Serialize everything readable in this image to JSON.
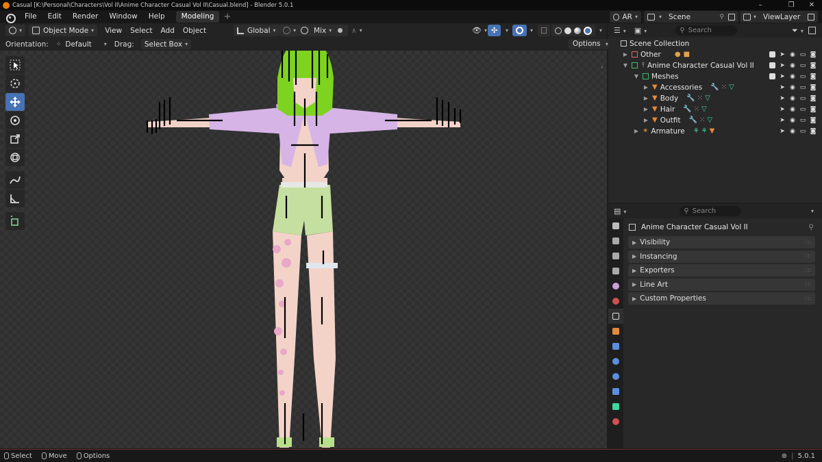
{
  "window": {
    "title": "Casual [K:\\Personal\\Characters\\Vol II\\Anime Character Casual Vol II\\Casual.blend] - Blender 5.0.1",
    "minimize": "–",
    "maximize": "❐",
    "close": "✕"
  },
  "menubar": {
    "items": [
      "File",
      "Edit",
      "Render",
      "Window",
      "Help"
    ],
    "workspace_tab": "Modeling",
    "add_tab": "+",
    "engine": "AR",
    "scene": "Scene",
    "view_layer": "ViewLayer"
  },
  "viewport_header": {
    "mode": "Object Mode",
    "menus": [
      "View",
      "Select",
      "Add",
      "Object"
    ],
    "transform_orientation": "Global",
    "snap_mode": "Mix"
  },
  "viewport_subheader": {
    "orientation_label": "Orientation:",
    "orientation_value": "Default",
    "drag_label": "Drag:",
    "drag_value": "Select Box",
    "options": "Options"
  },
  "tools": [
    "select-box",
    "cursor",
    "move",
    "rotate",
    "scale",
    "transform",
    "annotate",
    "measure",
    "add-cube"
  ],
  "outliner": {
    "search_placeholder": "Search",
    "rows": [
      {
        "label": "Scene Collection"
      },
      {
        "label": "Other"
      },
      {
        "label": "Anime Character Casual Vol II"
      },
      {
        "label": "Meshes"
      },
      {
        "label": "Accessories"
      },
      {
        "label": "Body"
      },
      {
        "label": "Hair"
      },
      {
        "label": "Outfit"
      },
      {
        "label": "Armature"
      }
    ]
  },
  "properties": {
    "search_placeholder": "Search",
    "object_name": "Anime Character Casual Vol II",
    "panels": [
      "Visibility",
      "Instancing",
      "Exporters",
      "Line Art",
      "Custom Properties"
    ]
  },
  "statusbar": {
    "select": "Select",
    "move": "Move",
    "options": "Options",
    "version": "5.0.1"
  },
  "colors": {
    "accent": "#4772b3",
    "hair": "#7ed321",
    "shirt": "#d6b4e6",
    "shorts": "#c5dfa0",
    "skin": "#f3d3c8",
    "mesh_icon": "#e58a3a",
    "collection_icon": "#3fbf6f"
  }
}
